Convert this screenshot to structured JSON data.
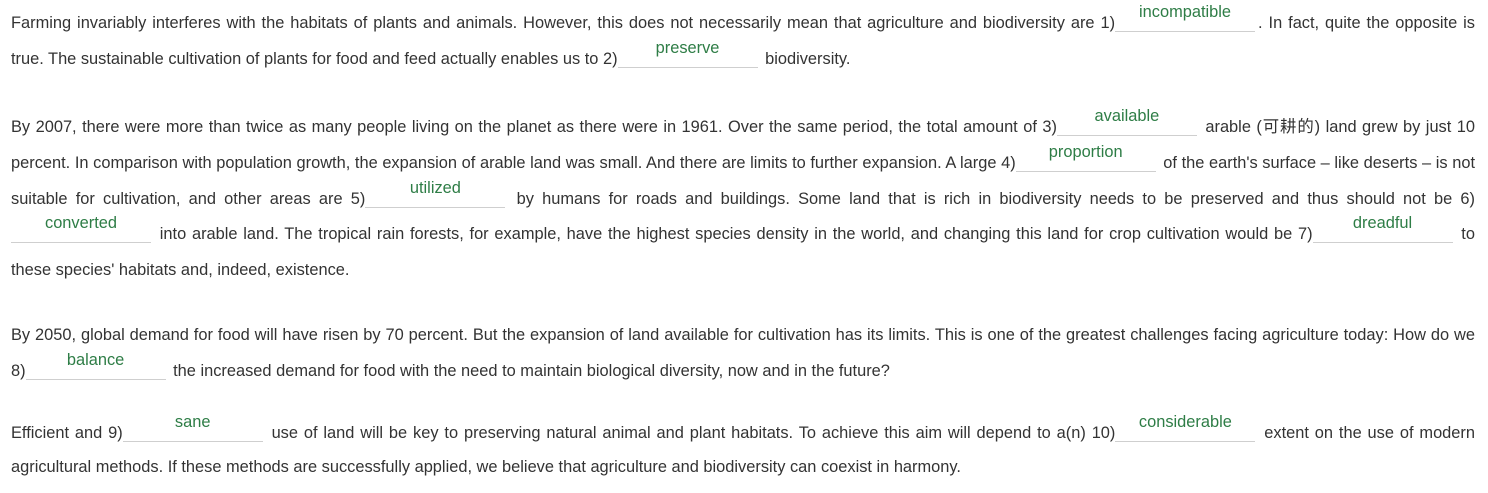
{
  "paragraphs": [
    {
      "segments": [
        {
          "type": "text",
          "value": "Farming invariably interferes with the habitats of plants and animals. However, this does not necessarily mean that agriculture and biodiversity are 1)"
        },
        {
          "type": "blank",
          "value": "incompatible"
        },
        {
          "type": "text",
          "value": ". In fact, quite the opposite is true. The sustainable cultivation of plants for food and feed actually enables us to 2)"
        },
        {
          "type": "blank",
          "value": "preserve"
        },
        {
          "type": "text",
          "value": " biodiversity."
        }
      ]
    },
    {
      "segments": [
        {
          "type": "text",
          "value": "By 2007, there were more than twice as many people living on the planet as there were in 1961. Over the same period, the total amount of 3)"
        },
        {
          "type": "blank",
          "value": "available"
        },
        {
          "type": "text",
          "value": " arable (可耕的) land grew by just 10 percent. In comparison with population growth, the expansion of arable land was small. And there are limits to further expansion. A large 4)"
        },
        {
          "type": "blank",
          "value": "proportion"
        },
        {
          "type": "text",
          "value": " of the earth's surface – like deserts – is not suitable for cultivation, and other areas are 5)"
        },
        {
          "type": "blank",
          "value": "utilized"
        },
        {
          "type": "text",
          "value": " by humans for roads and buildings. Some land that is rich in biodiversity needs to be preserved and thus should not be 6)"
        },
        {
          "type": "blank",
          "value": "converted"
        },
        {
          "type": "text",
          "value": " into arable land. The tropical rain forests, for example, have the highest species density in the world, and changing this land for crop cultivation would be 7)"
        },
        {
          "type": "blank",
          "value": "dreadful"
        },
        {
          "type": "text",
          "value": " to these species' habitats and, indeed, existence."
        }
      ]
    },
    {
      "segments": [
        {
          "type": "text",
          "value": "By 2050, global demand for food will have risen by 70 percent. But the expansion of land available for cultivation has its limits. This is one of the greatest challenges facing agriculture today: How do we 8)"
        },
        {
          "type": "blank",
          "value": "balance"
        },
        {
          "type": "text",
          "value": " the increased demand for food with the need to maintain biological diversity, now and in the future?"
        }
      ]
    },
    {
      "segments": [
        {
          "type": "text",
          "value": "Efficient and 9)"
        },
        {
          "type": "blank",
          "value": "sane"
        },
        {
          "type": "text",
          "value": " use of land will be key to preserving natural animal and plant habitats. To achieve this aim will depend to a(n) 10)"
        },
        {
          "type": "blank",
          "value": "considerable"
        },
        {
          "type": "text",
          "value": " extent on the use of modern agricultural methods. If these methods are successfully applied, we believe that agriculture and biodiversity can coexist in harmony."
        }
      ]
    }
  ],
  "colors": {
    "text": "#333333",
    "answer": "#2e7d46",
    "blank_line": "#cfcfcf"
  }
}
